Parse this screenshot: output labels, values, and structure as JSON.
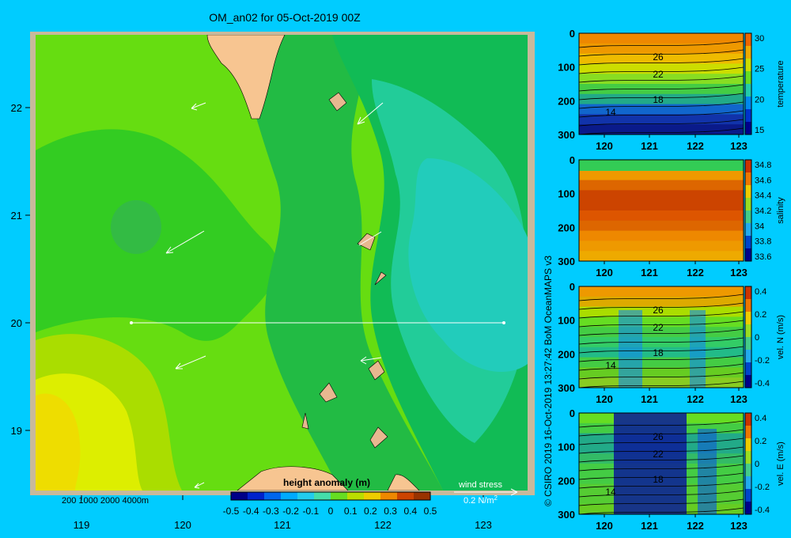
{
  "title": "OM_an02 for 05-Oct-2019 00Z",
  "credit": "© CSIRO 2019   16-Oct-2019 13:27:42 BoM OceanMAPS v3",
  "map": {
    "lon_ticks": [
      "119",
      "120",
      "121",
      "122",
      "123"
    ],
    "lat_ticks": [
      "22",
      "21",
      "20",
      "19"
    ],
    "depth_legend": "200  1000  2000  4000m",
    "colorbar_title": "height anomaly (m)",
    "colorbar_ticks": [
      "-0.5",
      "-0.4",
      "-0.3",
      "-0.2",
      "-0.1",
      "0",
      "0.1",
      "0.2",
      "0.3",
      "0.4",
      "0.5"
    ],
    "wind_label": "wind stress",
    "wind_scale": "0.2 N/m",
    "wind_scale_sup": "2",
    "colors": {
      "land": "#f7c591",
      "frame": "#c8b99c",
      "background": "#00ccff"
    }
  },
  "sections": {
    "x_ticks": [
      "120",
      "121",
      "122",
      "123"
    ],
    "y_ticks": [
      "0",
      "100",
      "200",
      "300"
    ],
    "panels": [
      {
        "label": "temperature",
        "cbar_ticks": [
          "30",
          "25",
          "20",
          "15"
        ],
        "contours": [
          "26",
          "22",
          "18",
          "14"
        ]
      },
      {
        "label": "salinity",
        "cbar_ticks": [
          "34.8",
          "34.6",
          "34.4",
          "34.2",
          "34",
          "33.8",
          "33.6"
        ],
        "contours": []
      },
      {
        "label": "vel. N (m/s)",
        "cbar_ticks": [
          "0.4",
          "0.2",
          "0",
          "-0.2",
          "-0.4"
        ],
        "contours": [
          "26",
          "22",
          "18",
          "14"
        ]
      },
      {
        "label": "vel. E (m/s)",
        "cbar_ticks": [
          "0.4",
          "0.2",
          "0",
          "-0.2",
          "-0.4"
        ],
        "contours": [
          "26",
          "22",
          "18",
          "14"
        ]
      }
    ]
  }
}
